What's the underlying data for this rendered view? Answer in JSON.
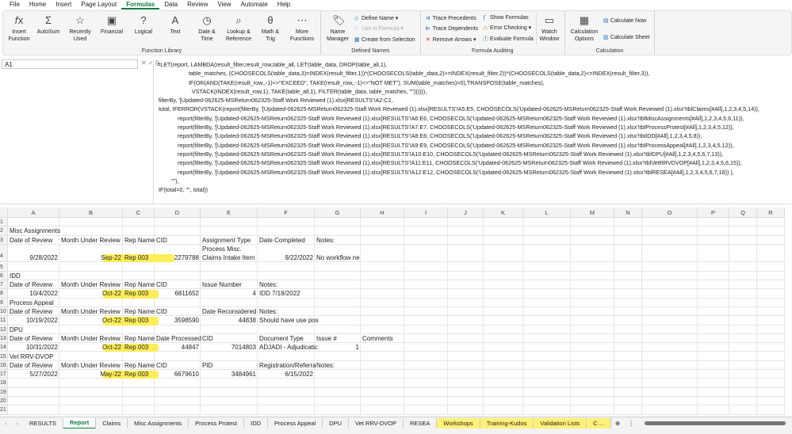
{
  "menu": [
    "File",
    "Home",
    "Insert",
    "Page Layout",
    "Formulas",
    "Data",
    "Review",
    "View",
    "Automate",
    "Help"
  ],
  "active_menu": "Formulas",
  "ribbon": {
    "function_library": {
      "label": "Function Library",
      "buttons": [
        {
          "label": "Insert Function",
          "icon": "fx-icon"
        },
        {
          "label": "AutoSum",
          "icon": "sigma-icon"
        },
        {
          "label": "Recently Used",
          "icon": "star-icon"
        },
        {
          "label": "Financial",
          "icon": "financial-icon"
        },
        {
          "label": "Logical",
          "icon": "logical-icon"
        },
        {
          "label": "Text",
          "icon": "text-icon"
        },
        {
          "label": "Date & Time",
          "icon": "clock-icon"
        },
        {
          "label": "Lookup & Reference",
          "icon": "lookup-icon"
        },
        {
          "label": "Math & Trig",
          "icon": "math-icon"
        },
        {
          "label": "More Functions",
          "icon": "more-icon"
        }
      ]
    },
    "defined_names": {
      "label": "Defined Names",
      "name_manager": "Name Manager",
      "define_name": "Define Name",
      "use_in_formula": "Use in Formula",
      "create_from_selection": "Create from Selection"
    },
    "formula_auditing": {
      "label": "Formula Auditing",
      "trace_precedents": "Trace Precedents",
      "trace_dependents": "Trace Dependents",
      "remove_arrows": "Remove Arrows",
      "show_formulas": "Show Formulas",
      "error_checking": "Error Checking",
      "evaluate_formula": "Evaluate Formula",
      "watch_window": "Watch Window"
    },
    "calculation": {
      "label": "Calculation",
      "options": "Calculation Options",
      "calc_now": "Calculate Now",
      "calc_sheet": "Calculate Sheet"
    }
  },
  "name_box": "A1",
  "formula": "=LET(report, LAMBDA(result_filter,result_row,table_all, LET(table_data, DROP(table_all,1),\n                    table_matches, (CHOOSECOLS(table_data,3)=INDEX(result_filter,1))*(CHOOSECOLS(table_data,2)>=INDEX(result_filter,2))*(CHOOSECOLS(table_data,2)<=INDEX(result_filter,3)),\n                    IF(OR(AND(TAKE(result_row,,-1)<>\"EXCEED\", TAKE(result_row,,-1)<>\"NOT MET\"), SUM(table_matches)=0),TRANSPOSE(table_matches),\n                      VSTACK(INDEX(result_row,1), TAKE(table_all,1), FILTER(table_data, table_matches, \"\")))))),\n filterBy, '[Updated-062625-MSReturn062325-Staff Work Reviewed (1).xlsx]RESULTS'!A2:C2,\n total, IFERROR(VSTACK(report(filterBy, '[Updated-062625-MSReturn062325-Staff Work Reviewed (1).xlsx]RESULTS'!A5:E5, CHOOSECOLS('Updated-062625-MSReturn062325-Staff Work Reviewed (1).xlsx'!tblClaims[#All],1,2,3,4,5,14)),\n             report(filterBy, '[Updated-062625-MSReturn062325-Staff Work Reviewed (1).xlsx]RESULTS'!A6:E6, CHOOSECOLS('Updated-062625-MSReturn062325-Staff Work Reviewed (1).xlsx'!tblMiscAssignments[#All],1,2,3,4,5,6,11)),\n             report(filterBy, '[Updated-062625-MSReturn062325-Staff Work Reviewed (1).xlsx]RESULTS'!A7:E7, CHOOSECOLS('Updated-062625-MSReturn062325-Staff Work Reviewed (1).xlsx'!tblProcessProtest[#All],1,2,3,4,5,12)),\n             report(filterBy, '[Updated-062625-MSReturn062325-Staff Work Reviewed (1).xlsx]RESULTS'!A8:E8, CHOOSECOLS('Updated-062625-MSReturn062325-Staff Work Reviewed (1).xlsx'!tblIDD[#All],1,2,3,4,5,8)),\n             report(filterBy, '[Updated-062625-MSReturn062325-Staff Work Reviewed (1).xlsx]RESULTS'!A9:E9, CHOOSECOLS('Updated-062625-MSReturn062325-Staff Work Reviewed (1).xlsx'!tblProcessAppeal[#All],1,2,3,4,5,12)),\n             report(filterBy, '[Updated-062625-MSReturn062325-Staff Work Reviewed (1).xlsx]RESULTS'!A10:E10, CHOOSECOLS('Updated-062625-MSReturn062325-Staff Work Reviewed (1).xlsx'!tblDPU[#All],1,2,3,4,5,6,7,13)),\n             report(filterBy, '[Updated-062625-MSReturn062325-Staff Work Reviewed (1).xlsx]RESULTS'!A11:E11, CHOOSECOLS('Updated-062625-MSReturn062325-Staff Work Reviewed (1).xlsx'!tblVetRRVDVOP[#All],1,2,3,4,5,6,15)),\n             report(filterBy, '[Updated-062625-MSReturn062325-Staff Work Reviewed (1).xlsx]RESULTS'!A12:E12, CHOOSECOLS('Updated-062625-MSReturn062325-Staff Work Reviewed (1).xlsx'!tblRESEA[#All],1,2,3,4,5,6,7,18)) ),\n         \"\"),\n IF(total=0, \"\", total))",
  "columns": [
    "A",
    "B",
    "C",
    "D",
    "E",
    "F",
    "G",
    "H",
    "I",
    "J",
    "K",
    "L",
    "M",
    "N",
    "O",
    "P",
    "Q",
    "R"
  ],
  "rows": [
    "1",
    "2",
    "3",
    "4",
    "5",
    "6",
    "7",
    "8",
    "9",
    "10",
    "11",
    "12",
    "13",
    "14",
    "15",
    "16",
    "17",
    "18",
    "19",
    "20",
    "21"
  ],
  "cells": [
    {
      "r": 2,
      "c": "A",
      "v": "Misc Assignments"
    },
    {
      "r": 3,
      "c": "A",
      "v": "Date of Review"
    },
    {
      "r": 3,
      "c": "B",
      "v": "Month Under Review"
    },
    {
      "r": 3,
      "c": "C",
      "v": "Rep Name"
    },
    {
      "r": 3,
      "c": "D",
      "v": "CID"
    },
    {
      "r": 3,
      "c": "E",
      "v": "Assignment Type"
    },
    {
      "r": 3,
      "c": "F",
      "v": "Date Completed"
    },
    {
      "r": 3,
      "c": "G",
      "v": "Notes:"
    },
    {
      "r": 4,
      "c": "A",
      "v": "9/28/2022",
      "n": 1
    },
    {
      "r": 4,
      "c": "B",
      "v": "Sep-22",
      "n": 1
    },
    {
      "r": 4,
      "c": "C",
      "v": "Rep 003"
    },
    {
      "r": 4,
      "c": "D",
      "v": "2279788",
      "n": 1
    },
    {
      "r": 4,
      "c": "E",
      "v": "Process Misc.\nClaims Intake Item"
    },
    {
      "r": 4,
      "c": "F",
      "v": "9/22/2022",
      "n": 1
    },
    {
      "r": 4,
      "c": "G",
      "v": "No workflow ne"
    },
    {
      "r": 6,
      "c": "A",
      "v": "IDD"
    },
    {
      "r": 7,
      "c": "A",
      "v": "Date of Review"
    },
    {
      "r": 7,
      "c": "B",
      "v": "Month Under Review"
    },
    {
      "r": 7,
      "c": "C",
      "v": "Rep Name"
    },
    {
      "r": 7,
      "c": "D",
      "v": "CID"
    },
    {
      "r": 7,
      "c": "E",
      "v": "Issue Number"
    },
    {
      "r": 7,
      "c": "F",
      "v": "Notes:"
    },
    {
      "r": 8,
      "c": "A",
      "v": "10/4/2022",
      "n": 1
    },
    {
      "r": 8,
      "c": "B",
      "v": "Oct-22",
      "n": 1
    },
    {
      "r": 8,
      "c": "C",
      "v": "Rep 003"
    },
    {
      "r": 8,
      "c": "D",
      "v": "6811652",
      "n": 1
    },
    {
      "r": 8,
      "c": "E",
      "v": "4",
      "n": 1
    },
    {
      "r": 8,
      "c": "F",
      "v": "IDD 7/18/2022"
    },
    {
      "r": 9,
      "c": "A",
      "v": "Process Appeal"
    },
    {
      "r": 10,
      "c": "A",
      "v": "Date of Review"
    },
    {
      "r": 10,
      "c": "B",
      "v": "Month Under Review"
    },
    {
      "r": 10,
      "c": "C",
      "v": "Rep Name"
    },
    {
      "r": 10,
      "c": "D",
      "v": "CID"
    },
    {
      "r": 10,
      "c": "E",
      "v": "Date Reconsidered"
    },
    {
      "r": 10,
      "c": "F",
      "v": "Notes:"
    },
    {
      "r": 11,
      "c": "A",
      "v": "10/19/2022",
      "n": 1
    },
    {
      "r": 11,
      "c": "B",
      "v": "Oct-22",
      "n": 1
    },
    {
      "r": 11,
      "c": "C",
      "v": "Rep 003"
    },
    {
      "r": 11,
      "c": "D",
      "v": "3598590",
      "n": 1
    },
    {
      "r": 11,
      "c": "E",
      "v": "44838",
      "n": 1
    },
    {
      "r": 11,
      "c": "F",
      "v": "Should have use pos"
    },
    {
      "r": 12,
      "c": "A",
      "v": "DPU"
    },
    {
      "r": 13,
      "c": "A",
      "v": "Date of Review"
    },
    {
      "r": 13,
      "c": "B",
      "v": "Month Under Review"
    },
    {
      "r": 13,
      "c": "C",
      "v": "Rep Name"
    },
    {
      "r": 13,
      "c": "D",
      "v": "Date Processed"
    },
    {
      "r": 13,
      "c": "E",
      "v": "CID"
    },
    {
      "r": 13,
      "c": "F",
      "v": "Document Type"
    },
    {
      "r": 13,
      "c": "G",
      "v": "Issue #"
    },
    {
      "r": 13,
      "c": "H",
      "v": "Comments"
    },
    {
      "r": 14,
      "c": "A",
      "v": "10/31/2022",
      "n": 1
    },
    {
      "r": 14,
      "c": "B",
      "v": "Oct-22",
      "n": 1
    },
    {
      "r": 14,
      "c": "C",
      "v": "Rep 003"
    },
    {
      "r": 14,
      "c": "D",
      "v": "44847",
      "n": 1
    },
    {
      "r": 14,
      "c": "E",
      "v": "7014803",
      "n": 1
    },
    {
      "r": 14,
      "c": "F",
      "v": "ADJADI - Adjudicatic"
    },
    {
      "r": 14,
      "c": "G",
      "v": "1",
      "n": 1
    },
    {
      "r": 15,
      "c": "A",
      "v": "Vet RRV-DVOP"
    },
    {
      "r": 16,
      "c": "A",
      "v": "Date of Review"
    },
    {
      "r": 16,
      "c": "B",
      "v": "Month Under Review"
    },
    {
      "r": 16,
      "c": "C",
      "v": "Rep Name"
    },
    {
      "r": 16,
      "c": "D",
      "v": "CID"
    },
    {
      "r": 16,
      "c": "E",
      "v": "PID"
    },
    {
      "r": 16,
      "c": "F",
      "v": "Registration/Referra"
    },
    {
      "r": 16,
      "c": "G",
      "v": "Notes:"
    },
    {
      "r": 17,
      "c": "A",
      "v": "5/27/2022",
      "n": 1
    },
    {
      "r": 17,
      "c": "B",
      "v": "May-22",
      "n": 1
    },
    {
      "r": 17,
      "c": "C",
      "v": "Rep 003"
    },
    {
      "r": 17,
      "c": "D",
      "v": "6679610",
      "n": 1
    },
    {
      "r": 17,
      "c": "E",
      "v": "3484961",
      "n": 1
    },
    {
      "r": 17,
      "c": "F",
      "v": "6/15/2022",
      "n": 1
    }
  ],
  "highlight_color": "#ffeb3b",
  "highlight_rows": [
    4,
    8,
    11,
    14,
    17
  ],
  "sheet_tabs": [
    {
      "label": "RESULTS"
    },
    {
      "label": "Report",
      "active": true
    },
    {
      "label": "Claims"
    },
    {
      "label": "Misc Assignments"
    },
    {
      "label": "Process Protest"
    },
    {
      "label": "IDD"
    },
    {
      "label": "Process Appeal"
    },
    {
      "label": "DPU"
    },
    {
      "label": "Vet RRV-DVOP"
    },
    {
      "label": "RESEA"
    },
    {
      "label": "Workshops",
      "highlight": true
    },
    {
      "label": "Training-Kudos",
      "highlight": true
    },
    {
      "label": "Validation Lists",
      "highlight": true
    },
    {
      "label": "C ...",
      "highlight": true
    }
  ]
}
